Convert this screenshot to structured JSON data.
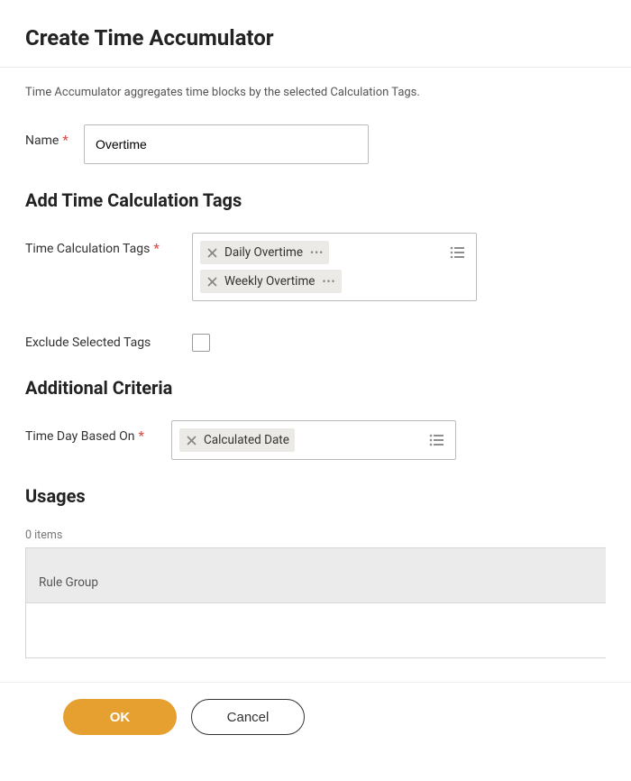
{
  "header": {
    "title": "Create Time Accumulator"
  },
  "description": "Time Accumulator aggregates time blocks by the selected Calculation Tags.",
  "name": {
    "label": "Name",
    "value": "Overtime"
  },
  "sections": {
    "addTags": "Add Time Calculation Tags",
    "additionalCriteria": "Additional Criteria",
    "usages": "Usages"
  },
  "tags": {
    "label": "Time Calculation Tags",
    "items": [
      "Daily Overtime",
      "Weekly Overtime"
    ]
  },
  "exclude": {
    "label": "Exclude Selected Tags",
    "checked": false
  },
  "timeBased": {
    "label": "Time Day Based On",
    "items": [
      "Calculated Date"
    ]
  },
  "usages": {
    "countText": "0 items",
    "columns": [
      "Rule Group"
    ]
  },
  "footer": {
    "ok": "OK",
    "cancel": "Cancel"
  }
}
